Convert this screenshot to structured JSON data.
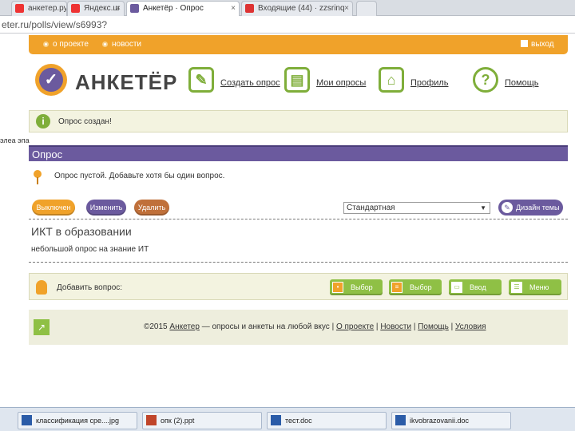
{
  "browser": {
    "tabs": [
      {
        "title": "анкетер.ру",
        "active": false
      },
      {
        "title": "Яндекс.ш",
        "active": false
      },
      {
        "title": "Анкетёр · Опрос",
        "active": true
      },
      {
        "title": "Входящие (44) · zzsrinq",
        "active": false
      }
    ],
    "close_glyph": "×",
    "url": "eter.ru/polls/view/s6993?"
  },
  "topnav": {
    "about": "о проекте",
    "news": "новости",
    "logout": "выход"
  },
  "brand": {
    "logo_text": "АНКЕТЁР",
    "logo_glyph": "✓"
  },
  "mainnav": [
    {
      "label": "Создать опрос",
      "icon": "pencil-icon",
      "glyph": "✎"
    },
    {
      "label": "Мои опросы",
      "icon": "folder-icon",
      "glyph": "▤"
    },
    {
      "label": "Профиль",
      "icon": "lock-icon",
      "glyph": "⌂"
    },
    {
      "label": "Помощь",
      "icon": "help-icon",
      "glyph": "?"
    }
  ],
  "notice": {
    "icon_glyph": "i",
    "text": "Опрос создан!"
  },
  "breadcrumb": "элеа эпа",
  "section": {
    "title": "Опрос"
  },
  "hint": {
    "text": "Опрос пустой. Добавьте хотя бы один вопрос."
  },
  "actions": {
    "disabled": "Выключен",
    "edit": "Изменить",
    "delete": "Удалить"
  },
  "theme": {
    "selected": "Стандартная",
    "design_button": "Дизайн темы"
  },
  "poll": {
    "title": "ИКТ в образовании",
    "description": "небольшой опрос на знание ИТ"
  },
  "add_question": {
    "label": "Добавить вопрос:",
    "types": [
      {
        "label": "Выбор",
        "icon": "choice-icon"
      },
      {
        "label": "Выбор",
        "icon": "multi-choice-icon"
      },
      {
        "label": "Ввод",
        "icon": "input-icon"
      },
      {
        "label": "Меню",
        "icon": "menu-icon"
      }
    ]
  },
  "footer": {
    "copyright": "©2015",
    "brand": "Анкетер",
    "tagline": "— опросы и анкеты на любой вкус",
    "links": [
      "О проекте",
      "Новости",
      "Помощь",
      "Условия"
    ],
    "separator": "|"
  },
  "taskbar": [
    "классификация сре....jpg",
    "опк (2).ppt",
    "тест.doc",
    "ikvobrazovanii.doc"
  ],
  "colors": {
    "orange": "#f0a22a",
    "purple": "#6b5a9e",
    "green": "#8fc045",
    "brown": "#c0703a"
  }
}
